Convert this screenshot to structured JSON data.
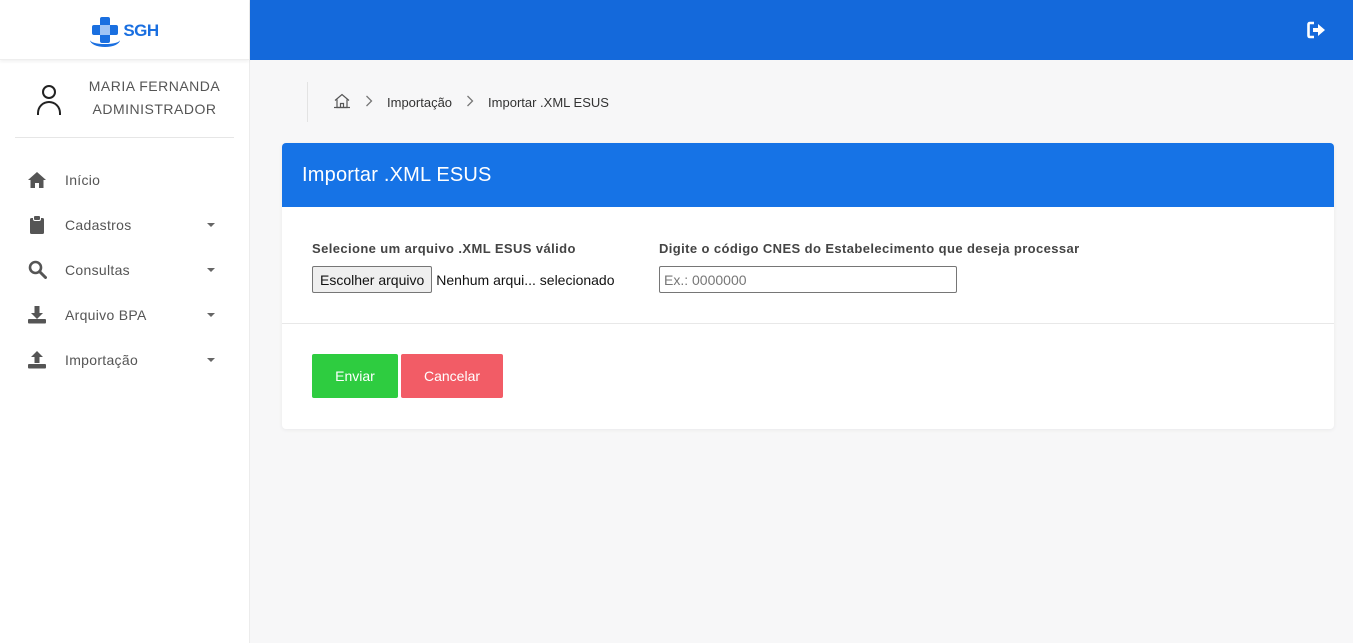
{
  "brand": {
    "logo_text": "SGH",
    "primary_color": "#1469db"
  },
  "user": {
    "name": "MARIA FERNANDA",
    "role": "ADMINISTRADOR"
  },
  "sidebar": {
    "items": [
      {
        "label": "Início",
        "icon": "home-icon",
        "has_submenu": false
      },
      {
        "label": "Cadastros",
        "icon": "clipboard-icon",
        "has_submenu": true
      },
      {
        "label": "Consultas",
        "icon": "search-icon",
        "has_submenu": true
      },
      {
        "label": "Arquivo BPA",
        "icon": "download-icon",
        "has_submenu": true
      },
      {
        "label": "Importação",
        "icon": "upload-icon",
        "has_submenu": true
      }
    ]
  },
  "topbar": {
    "logout_icon": "sign-out-icon"
  },
  "breadcrumb": {
    "home_icon": "home-icon",
    "items": [
      "Importação",
      "Importar .XML ESUS"
    ]
  },
  "card": {
    "title": "Importar .XML ESUS",
    "file_field": {
      "label": "Selecione um arquivo .XML ESUS válido",
      "button_label": "Escolher arquivo",
      "status": "Nenhum arqui... selecionado"
    },
    "cnes_field": {
      "label": "Digite o código CNES do Estabelecimento que deseja processar",
      "placeholder": "Ex.: 0000000",
      "value": ""
    },
    "actions": {
      "submit_label": "Enviar",
      "cancel_label": "Cancelar"
    }
  },
  "colors": {
    "header_blue": "#1673e6",
    "submit_green": "#2ecc40",
    "cancel_red": "#f25c66"
  }
}
